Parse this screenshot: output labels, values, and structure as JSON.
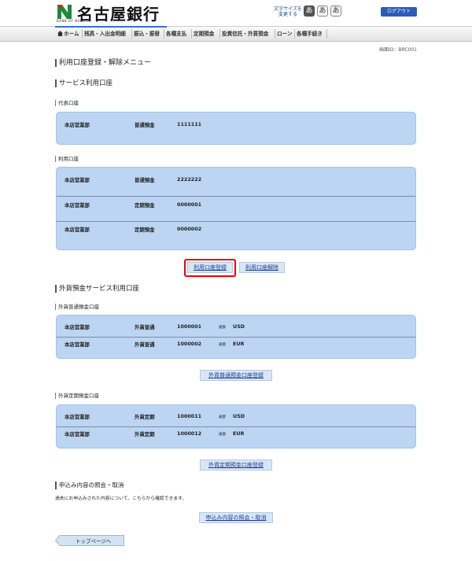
{
  "header": {
    "bank_name": "名古屋銀行",
    "bank_sub": "BANK OF NAGOYA",
    "font_size_label_1": "文字サイズを",
    "font_size_label_2": "変更する",
    "font_size_buttons": [
      "あ",
      "あ",
      "あ"
    ],
    "logout": "ログアウト"
  },
  "nav": {
    "items": [
      "ホーム",
      "残高・入出金明細",
      "振込・振替",
      "各種支払",
      "定期預金",
      "投資信託・外貨預金",
      "ローン",
      "各種手続き"
    ]
  },
  "screen_id": "画面ID：BRC001",
  "page_title": "利用口座登録・解除メニュー",
  "service_section": {
    "heading": "サービス利用口座",
    "representative": {
      "heading": "代表口座",
      "rows": [
        {
          "branch": "本店営業部",
          "type": "普通預金",
          "number": "1111111"
        }
      ]
    },
    "usage": {
      "heading": "利用口座",
      "rows": [
        {
          "branch": "本店営業部",
          "type": "普通預金",
          "number": "2222222"
        },
        {
          "branch": "本店営業部",
          "type": "定期預金",
          "number": "0000001"
        },
        {
          "branch": "本店営業部",
          "type": "定期預金",
          "number": "0000002"
        }
      ]
    },
    "register_button": "利用口座登録",
    "release_button": "利用口座解除"
  },
  "fx_section": {
    "heading": "外貨預金サービス利用口座",
    "ordinary": {
      "heading": "外貨普通預金口座",
      "rows": [
        {
          "branch": "本店営業部",
          "type": "外貨普通",
          "number": "1000001",
          "currency_label": "通貨",
          "currency": "USD"
        },
        {
          "branch": "本店営業部",
          "type": "外貨普通",
          "number": "1000002",
          "currency_label": "通貨",
          "currency": "EUR"
        }
      ],
      "button": "外貨普通預金口座登録"
    },
    "time": {
      "heading": "外貨定期預金口座",
      "rows": [
        {
          "branch": "本店営業部",
          "type": "外貨定期",
          "number": "1000011",
          "currency_label": "通貨",
          "currency": "USD"
        },
        {
          "branch": "本店営業部",
          "type": "外貨定期",
          "number": "1000012",
          "currency_label": "通貨",
          "currency": "EUR"
        }
      ],
      "button": "外貨定期預金口座登録"
    }
  },
  "inquiry_section": {
    "heading": "申込み内容の照会・取消",
    "description": "過去にお申込みされた内容について、こちらから確認できます。",
    "button": "申込み内容の照会・取消"
  },
  "top_page_button": "トップページへ",
  "colors": {
    "account_box": "#bcd5f2",
    "highlight": "#e00000",
    "link": "#1a3f92"
  }
}
